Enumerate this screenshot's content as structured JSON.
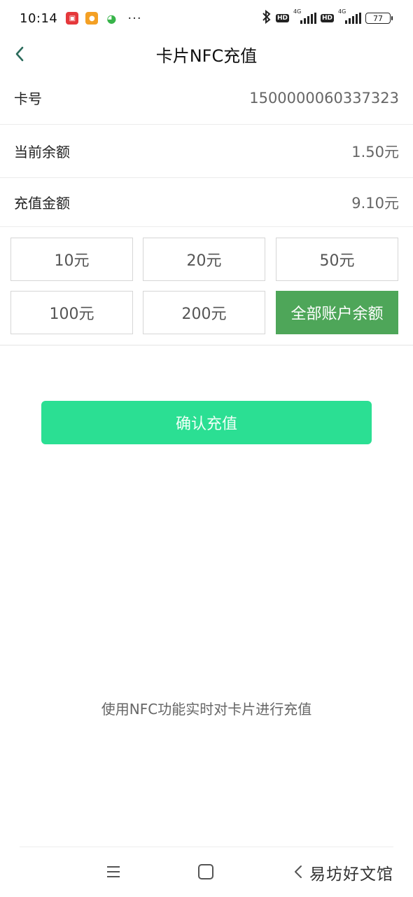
{
  "status_bar": {
    "time": "10:14",
    "more": "···",
    "hd1": "HD",
    "net1": "4G",
    "hd2": "HD",
    "net2": "4G",
    "battery": "77"
  },
  "header": {
    "title": "卡片NFC充值"
  },
  "card_info": {
    "card_no_label": "卡号",
    "card_no_value": "1500000060337323",
    "balance_label": "当前余额",
    "balance_value": "1.50元",
    "amount_label": "充值金额",
    "amount_value": "9.10元"
  },
  "amount_options": [
    {
      "label": "10元"
    },
    {
      "label": "20元"
    },
    {
      "label": "50元"
    },
    {
      "label": "100元"
    },
    {
      "label": "200元"
    },
    {
      "label": "全部账户余额"
    }
  ],
  "selected_option": "全部账户余额",
  "confirm_label": "确认充值",
  "hint": "使用NFC功能实时对卡片进行充值",
  "watermark": "易坊好文馆",
  "colors": {
    "accent": "#2bdf93",
    "selected": "#4ea659",
    "back_arrow": "#2a6b5b"
  }
}
